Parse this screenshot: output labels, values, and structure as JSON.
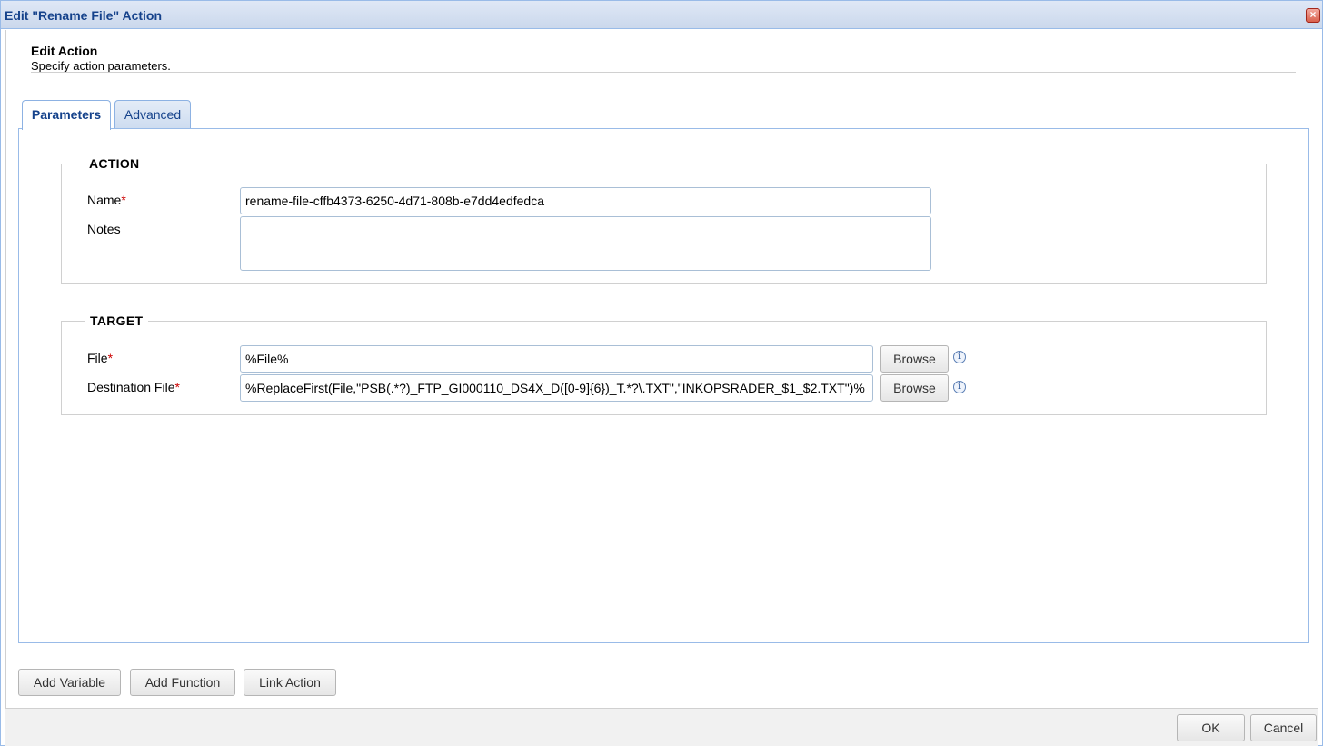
{
  "window": {
    "title": "Edit \"Rename File\" Action",
    "close_icon": "close-icon"
  },
  "header": {
    "title": "Edit Action",
    "subtitle": "Specify action parameters."
  },
  "tabs": [
    {
      "label": "Parameters",
      "active": true
    },
    {
      "label": "Advanced",
      "active": false
    }
  ],
  "action_group": {
    "legend": "ACTION",
    "name_label": "Name",
    "name_value": "rename-file-cffb4373-6250-4d71-808b-e7dd4edfedca",
    "notes_label": "Notes",
    "notes_value": ""
  },
  "target_group": {
    "legend": "TARGET",
    "file_label": "File",
    "file_value": "%File%",
    "dest_label": "Destination File",
    "dest_value": "%ReplaceFirst(File,\"PSB(.*?)_FTP_GI000110_DS4X_D([0-9]{6})_T.*?\\.TXT\",\"INKOPSRADER_$1_$2.TXT\")%",
    "browse_label": "Browse",
    "required_marker": "*"
  },
  "bottom_buttons": {
    "add_variable": "Add Variable",
    "add_function": "Add Function",
    "link_action": "Link Action"
  },
  "footer": {
    "ok": "OK",
    "cancel": "Cancel"
  },
  "colors": {
    "title_text": "#15428b",
    "border_accent": "#99bbe8",
    "required": "#cc0000"
  }
}
